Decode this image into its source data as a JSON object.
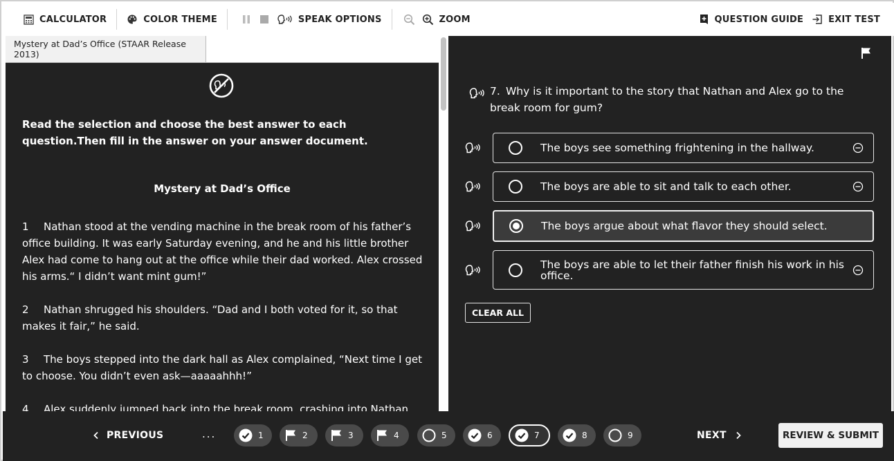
{
  "toolbar": {
    "calculator": "CALCULATOR",
    "color_theme": "COLOR THEME",
    "speak_options": "SPEAK OPTIONS",
    "zoom": "ZOOM",
    "question_guide": "QUESTION GUIDE",
    "exit_test": "EXIT TEST"
  },
  "passage": {
    "tab_title": "Mystery at Dad’s Office (STAAR Release 2013)",
    "instructions": "Read the selection and choose the best answer to each question.Then fill in the answer on your answer document.",
    "title": "Mystery at Dad’s Office",
    "paragraphs": [
      {
        "num": "1",
        "text": "Nathan stood at the vending machine in the break room of his father’s office building. It was early Saturday evening, and he and his little brother Alex had come to hang out at the office while their dad worked. Alex crossed his arms.“ I didn’t want mint gum!”"
      },
      {
        "num": "2",
        "text": "Nathan shrugged his shoulders. “Dad and I both voted for it, so that makes it fair,” he said."
      },
      {
        "num": "3",
        "text": "The boys stepped into the dark hall as Alex complained, “Next time I get to choose. You didn’t even ask—aaaaahhh!”"
      },
      {
        "num": "4",
        "text": "Alex suddenly jumped back into the break room, crashing into Nathan."
      }
    ]
  },
  "question": {
    "number": "7.",
    "text": "Why is it important to the story that Nathan and Alex go to the break room for gum?",
    "options": [
      {
        "text": "The boys see something frightening in the hallway.",
        "selected": false
      },
      {
        "text": "The boys are able to sit and talk to each other.",
        "selected": false
      },
      {
        "text": "The boys argue about what flavor they should select.",
        "selected": true
      },
      {
        "text": "The boys are able to let their father finish his work in his office.",
        "selected": false
      }
    ],
    "clear_all": "CLEAR ALL"
  },
  "nav": {
    "previous": "PREVIOUS",
    "next": "NEXT",
    "ellipsis": "...",
    "review_submit": "REVIEW & SUBMIT",
    "questions": [
      {
        "num": "1",
        "status": "answered"
      },
      {
        "num": "2",
        "status": "flagged"
      },
      {
        "num": "3",
        "status": "flagged"
      },
      {
        "num": "4",
        "status": "flagged"
      },
      {
        "num": "5",
        "status": "unanswered"
      },
      {
        "num": "6",
        "status": "answered"
      },
      {
        "num": "7",
        "status": "answered",
        "current": true
      },
      {
        "num": "8",
        "status": "answered"
      },
      {
        "num": "9",
        "status": "unanswered"
      }
    ]
  },
  "colors": {
    "dark_bg": "#222222",
    "pill_bg": "#4a4a4a",
    "light": "#ffffff"
  }
}
